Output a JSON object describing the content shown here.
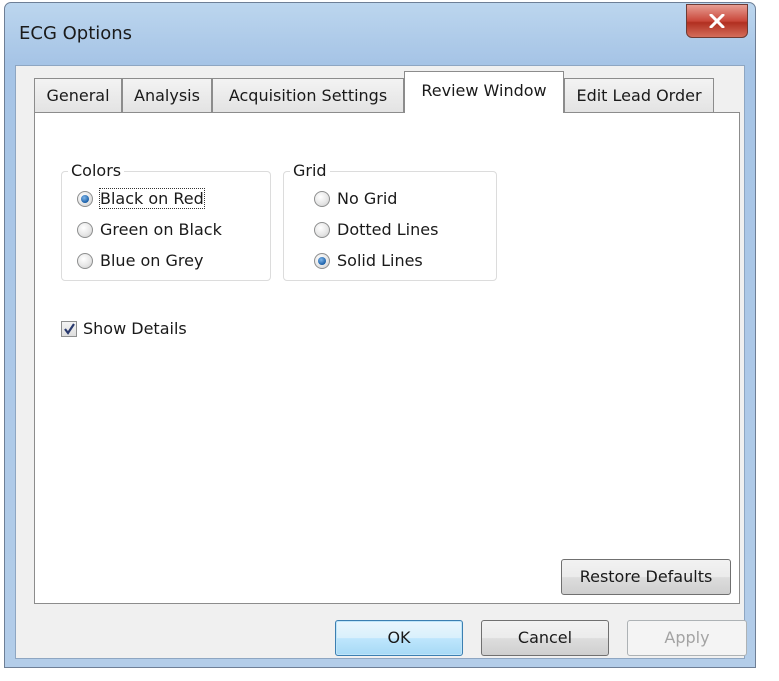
{
  "window": {
    "title": "ECG Options"
  },
  "tabs": [
    "General",
    "Analysis",
    "Acquisition Settings",
    "Review Window",
    "Edit Lead Order"
  ],
  "active_tab": "Review Window",
  "colors_group": {
    "label": "Colors",
    "options": [
      "Black on Red",
      "Green on Black",
      "Blue on Grey"
    ],
    "selected": "Black on Red"
  },
  "grid_group": {
    "label": "Grid",
    "options": [
      "No Grid",
      "Dotted Lines",
      "Solid Lines"
    ],
    "selected": "Solid Lines"
  },
  "show_details": {
    "label": "Show Details",
    "checked": true
  },
  "buttons": {
    "restore_defaults": "Restore Defaults",
    "ok": "OK",
    "cancel": "Cancel",
    "apply": "Apply"
  },
  "icons": {
    "close": "close-icon",
    "check": "checkmark-icon"
  },
  "colors": {
    "close_button": "#c9473a",
    "titlebar": "#bcd6ee",
    "radio_selected": "#1a5fa8"
  }
}
